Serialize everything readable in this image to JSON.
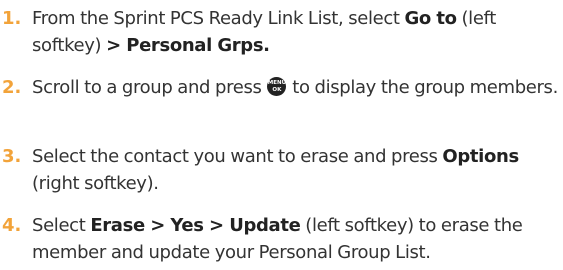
{
  "steps": [
    {
      "number": "1.",
      "parts": [
        {
          "t": "From the Sprint PCS Ready Link List, select "
        },
        {
          "t": "Go to",
          "b": true
        },
        {
          "t": " (left softkey) "
        },
        {
          "t": "> Personal Grps.",
          "b": true
        }
      ]
    },
    {
      "number": "2.",
      "parts": [
        {
          "t": "Scroll to a group and press "
        },
        {
          "icon": "menu-ok-key-icon"
        },
        {
          "t": " to display the group members."
        }
      ]
    },
    {
      "number": "3.",
      "parts": [
        {
          "t": "Select the contact you want to erase and press "
        },
        {
          "t": "Options",
          "b": true
        },
        {
          "t": " (right softkey)."
        }
      ]
    },
    {
      "number": "4.",
      "parts": [
        {
          "t": "Select "
        },
        {
          "t": "Erase > Yes > Update",
          "b": true
        },
        {
          "t": " (left softkey) to erase the member and update your Personal Group List."
        }
      ]
    }
  ],
  "icons": {
    "menu_ok_key": {
      "line1": "MENU",
      "line2": "OK"
    }
  },
  "colors": {
    "step_number": "#f2a33a",
    "text": "#333333"
  }
}
